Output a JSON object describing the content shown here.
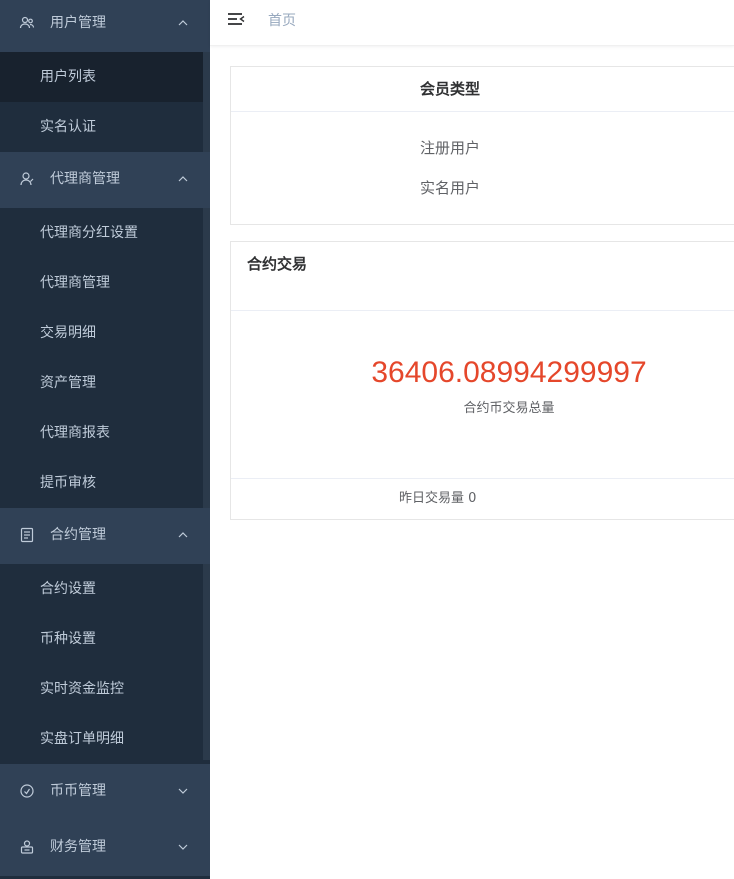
{
  "sidebar": {
    "groups": [
      {
        "label": "用户管理",
        "icon": "users-icon",
        "expanded": true,
        "items": [
          "用户列表",
          "实名认证"
        ]
      },
      {
        "label": "代理商管理",
        "icon": "user-icon",
        "expanded": true,
        "items": [
          "代理商分红设置",
          "代理商管理",
          "交易明细",
          "资产管理",
          "代理商报表",
          "提币审核"
        ]
      },
      {
        "label": "合约管理",
        "icon": "document-icon",
        "expanded": true,
        "items": [
          "合约设置",
          "币种设置",
          "实时资金监控",
          "实盘订单明细"
        ]
      },
      {
        "label": "币币管理",
        "icon": "coin-icon",
        "expanded": false,
        "items": []
      },
      {
        "label": "财务管理",
        "icon": "wallet-icon",
        "expanded": false,
        "items": []
      }
    ]
  },
  "header": {
    "breadcrumb": "首页"
  },
  "member_card": {
    "title": "会员类型",
    "rows": [
      "注册用户",
      "实名用户"
    ]
  },
  "contract_card": {
    "title": "合约交易",
    "total_value": "36406.08994299997",
    "total_caption": "合约币交易总量",
    "yesterday": "昨日交易量 0"
  },
  "colors": {
    "sidebar_bg": "#1f2d3d",
    "group_bg": "#304156",
    "accent_number": "#e5472b"
  }
}
